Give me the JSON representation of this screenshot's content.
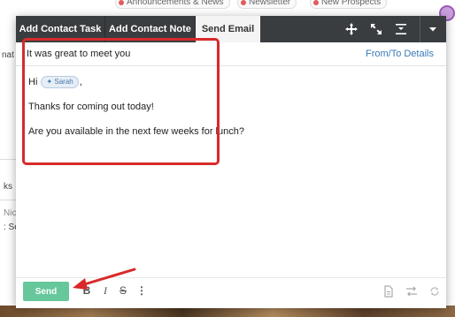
{
  "background": {
    "chips": [
      {
        "label": "Announcements & News",
        "dot": "#e25b5b"
      },
      {
        "label": "Newsletter",
        "dot": "#e25b5b"
      },
      {
        "label": "New Prospects",
        "dot": "#e25b5b"
      }
    ],
    "fragments": [
      "nat",
      "ks",
      "Nic",
      ": Se"
    ]
  },
  "tabs": [
    {
      "label": "Add Contact Task",
      "active": false
    },
    {
      "label": "Add Contact Note",
      "active": false
    },
    {
      "label": "Send Email",
      "active": true
    }
  ],
  "icons": {
    "move": "move-icon",
    "expand": "expand-icon",
    "collapse": "collapse-icon",
    "menu": "chevron-down-icon"
  },
  "email": {
    "subject": "It was great to meet you",
    "from_to_label": "From/To Details",
    "greeting": "Hi",
    "merge_tag": "Sarah",
    "greeting_suffix": ",",
    "line2": "Thanks for coming out today!",
    "line3": "Are you available in the next few weeks for lunch?"
  },
  "footer": {
    "send_label": "Send",
    "format": {
      "bold": "B",
      "italic": "I",
      "strike": "S",
      "more": "⋮"
    }
  },
  "colors": {
    "tabbar": "#3a3d40",
    "send": "#66c79a",
    "highlight": "#d82a2a",
    "link": "#3a7ab8"
  }
}
